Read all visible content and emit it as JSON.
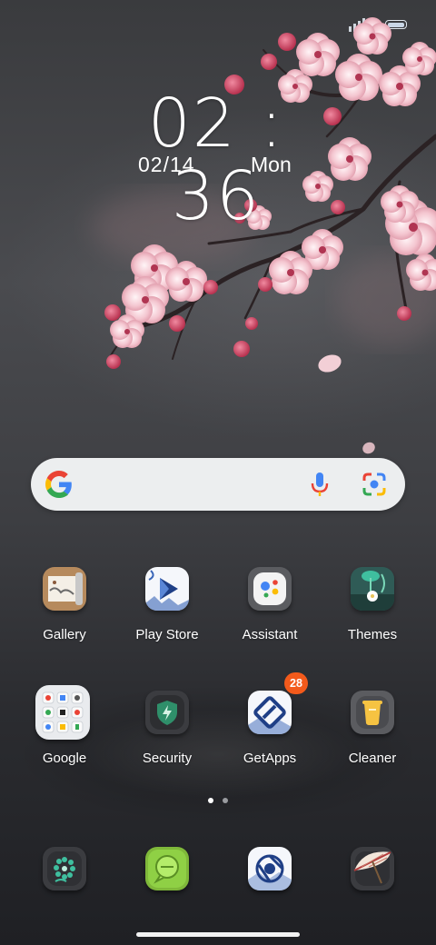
{
  "status_bar": {
    "signal_icon": "signal-icon",
    "battery_icon": "battery-icon"
  },
  "lock": {
    "time": "02 : 36",
    "date": "02/14",
    "weekday": "Mon"
  },
  "search": {
    "logo": "google-g-icon",
    "mic_icon": "microphone-icon",
    "lens_icon": "google-lens-icon"
  },
  "apps": [
    {
      "label": "Gallery",
      "icon": "gallery-icon"
    },
    {
      "label": "Play Store",
      "icon": "play-store-icon"
    },
    {
      "label": "Assistant",
      "icon": "assistant-icon"
    },
    {
      "label": "Themes",
      "icon": "themes-icon"
    },
    {
      "label": "Google",
      "icon": "google-folder-icon"
    },
    {
      "label": "Security",
      "icon": "shield-icon"
    },
    {
      "label": "GetApps",
      "icon": "getapps-icon",
      "badge": "28"
    },
    {
      "label": "Cleaner",
      "icon": "cleaner-icon"
    }
  ],
  "pages": {
    "count": 2,
    "current": 1
  },
  "dock": [
    {
      "icon": "phone-dialer-icon"
    },
    {
      "icon": "messages-icon"
    },
    {
      "icon": "browser-icon"
    },
    {
      "icon": "camera-umbrella-icon"
    }
  ],
  "colors": {
    "badge": "#f35a1b",
    "search_bg": "#eceeef",
    "accent_teal": "#3fbf9f"
  }
}
